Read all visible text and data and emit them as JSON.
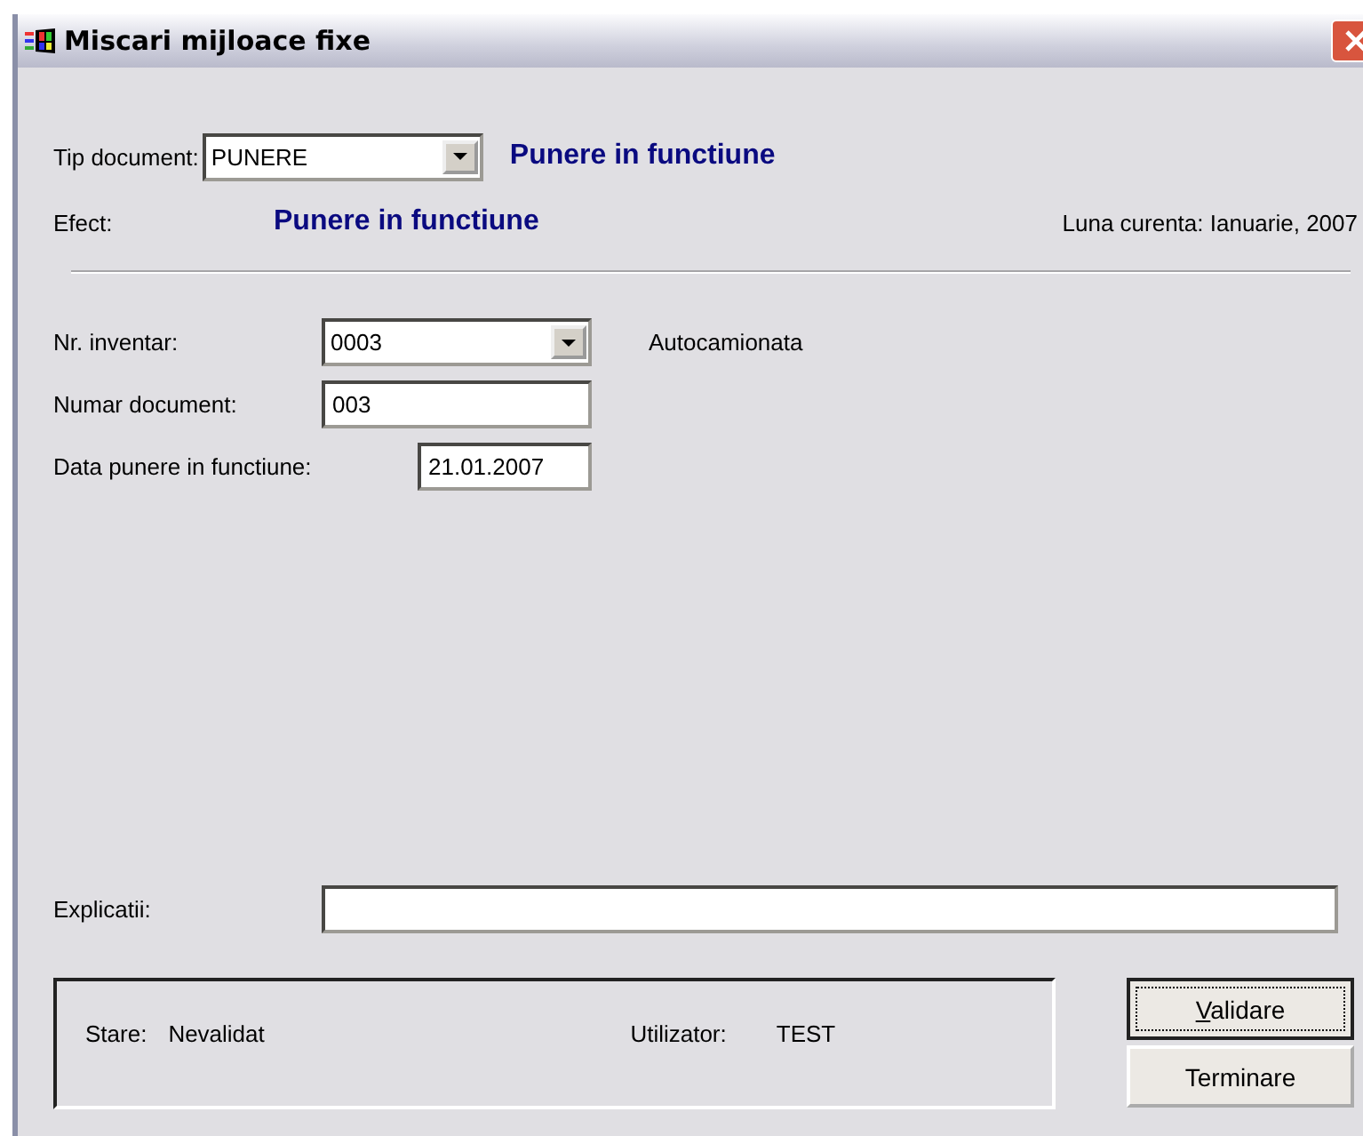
{
  "window": {
    "title": "Miscari mijloace fixe"
  },
  "tip_document": {
    "label": "Tip document:",
    "value": "PUNERE",
    "description": "Punere in functiune"
  },
  "efect": {
    "label": "Efect:",
    "value": "Punere in functiune"
  },
  "luna_curenta": "Luna curenta: Ianuarie, 2007",
  "fields": [
    {
      "kind": "combo",
      "label": "Nr. inventar:",
      "value": "0003",
      "note": "Autocamionata"
    },
    {
      "kind": "text",
      "label": "Numar document:",
      "value": "003"
    },
    {
      "kind": "date",
      "label": "Data punere in functiune:",
      "value": "21.01.2007"
    }
  ],
  "explicatii": {
    "label": "Explicatii:"
  },
  "status": {
    "stare_label": "Stare:",
    "stare": "Nevalidat",
    "utilizator_label": "Utilizator:",
    "utilizator": "TEST"
  },
  "buttons": [
    {
      "label": "Validare",
      "default": true
    },
    {
      "label": "Terminare",
      "default": false
    }
  ]
}
